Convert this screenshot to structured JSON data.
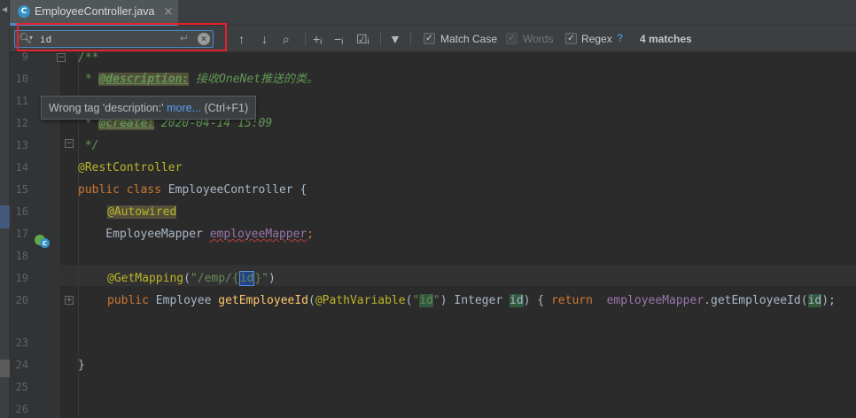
{
  "tab": {
    "filename": "EmployeeController.java",
    "icon": "C",
    "close": "×"
  },
  "find": {
    "query": "id",
    "match_case_label": "Match Case",
    "words_label": "Words",
    "regex_label": "Regex",
    "help": "?",
    "matches": "4 matches"
  },
  "tooltip": {
    "text": "Wrong tag 'description:' ",
    "link": "more...",
    "shortcut": " (Ctrl+F1)"
  },
  "lines": {
    "n9": "9",
    "n10": "10",
    "n11": "11",
    "n12": "12",
    "n13": "13",
    "n14": "14",
    "n15": "15",
    "n16": "16",
    "n17": "17",
    "n18": "18",
    "n19": "19",
    "n20": "20",
    "n23": "23",
    "n24": "24",
    "n25": "25",
    "n26": "26"
  },
  "code": {
    "l9": "/**",
    "l10_star": " * ",
    "l10_tag": "@description:",
    "l10_text": " 接收OneNet推送的类。",
    "l12_star": " * ",
    "l12_tag": "@create:",
    "l12_text": " 2020-04-14 15:09",
    "l13": " */",
    "l14": "@RestController",
    "l15_kw": "public class ",
    "l15_name": "EmployeeController {",
    "l16": "@Autowired",
    "l17_type": "    EmployeeMapper ",
    "l17_field": "employeeMapper",
    "l17_end": ";",
    "l19_ann": "@GetMapping",
    "l19_open": "(",
    "l19_str1": "\"/emp/{",
    "l19_id": "id",
    "l19_str2": "}\"",
    "l19_close": ")",
    "l20_kw1": "public ",
    "l20_type": "Employee ",
    "l20_fn": "getEmployeeId",
    "l20_p1": "(",
    "l20_ann": "@PathVariable",
    "l20_p2": "(",
    "l20_q1": "\"",
    "l20_id1": "id",
    "l20_q2": "\"",
    "l20_p3": ") Integer ",
    "l20_id2": "id",
    "l20_p4": ") { ",
    "l20_ret": "return  ",
    "l20_field": "employeeMapper",
    "l20_call": ".getEmployeeId(",
    "l20_id3": "id",
    "l20_end": ");",
    "l25": "}"
  }
}
